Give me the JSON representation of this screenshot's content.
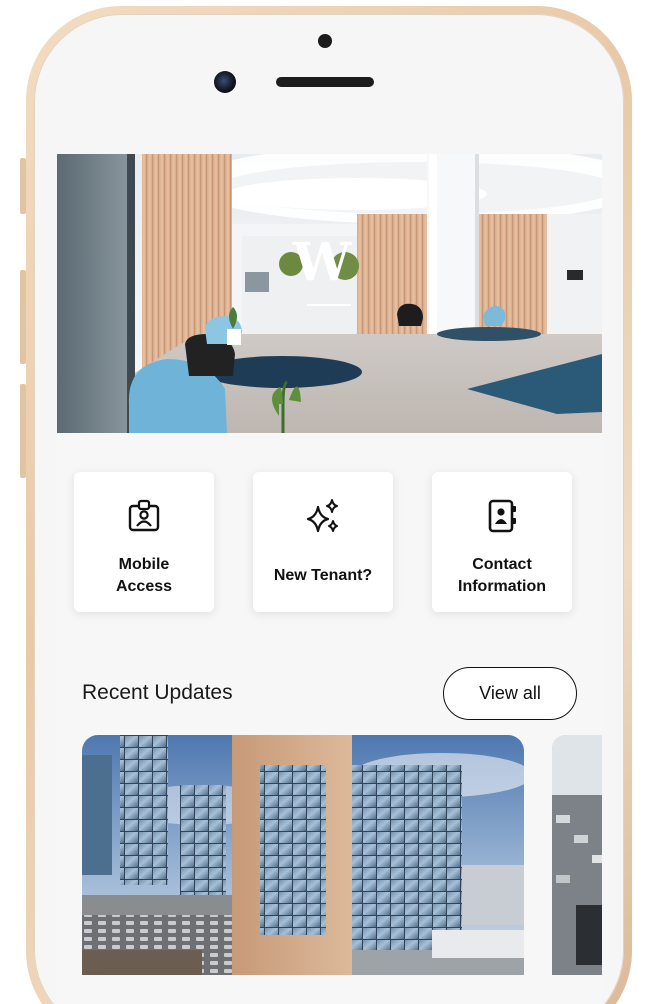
{
  "device": {
    "frame_color": "#ead0b2"
  },
  "hero": {
    "logo_letter": "W",
    "description": "Lobby photo with W logo"
  },
  "quick_actions": [
    {
      "label": "Mobile\nAccess",
      "icon": "id-badge-icon"
    },
    {
      "label": "New Tenant?",
      "icon": "sparkles-icon"
    },
    {
      "label": "Contact\nInformation",
      "icon": "contact-book-icon"
    }
  ],
  "recent_updates": {
    "title": "Recent Updates",
    "view_all_label": "View all"
  },
  "colors": {
    "background": "#f7f7f7",
    "card": "#ffffff",
    "text": "#111111"
  }
}
